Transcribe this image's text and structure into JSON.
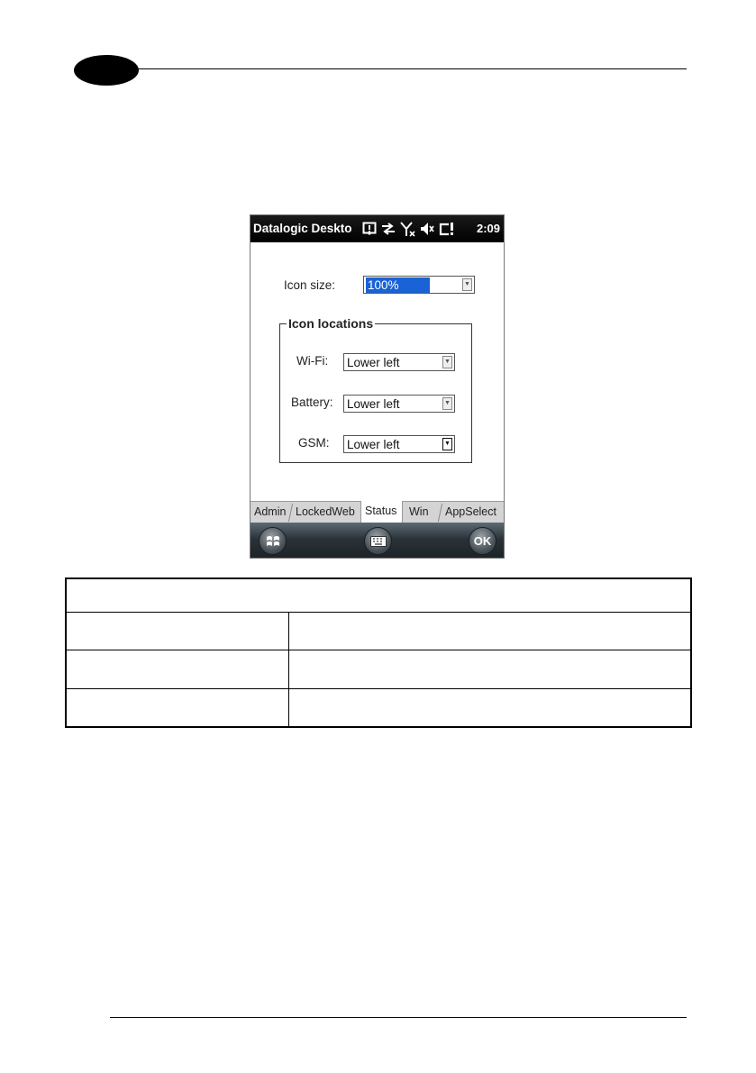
{
  "device": {
    "status_bar": {
      "title": "Datalogic Deskto",
      "clock": "2:09",
      "icons": [
        "notification-icon",
        "data-sync-icon",
        "no-signal-icon",
        "volume-muted-icon",
        "battery-alert-icon"
      ]
    },
    "form": {
      "icon_size_label": "Icon size:",
      "icon_size_value": "100%",
      "group_title": "Icon locations",
      "wifi_label": "Wi-Fi:",
      "wifi_value": "Lower left",
      "battery_label": "Battery:",
      "battery_value": "Lower left",
      "gsm_label": "GSM:",
      "gsm_value": "Lower left"
    },
    "tabs": [
      "Admin",
      "LockedWeb",
      "Status",
      "Win",
      "AppSelect"
    ],
    "active_tab": "Status",
    "softkeys": {
      "start_icon": "windows-start-icon",
      "keyboard_icon": "keyboard-icon",
      "ok_label": "OK"
    }
  }
}
